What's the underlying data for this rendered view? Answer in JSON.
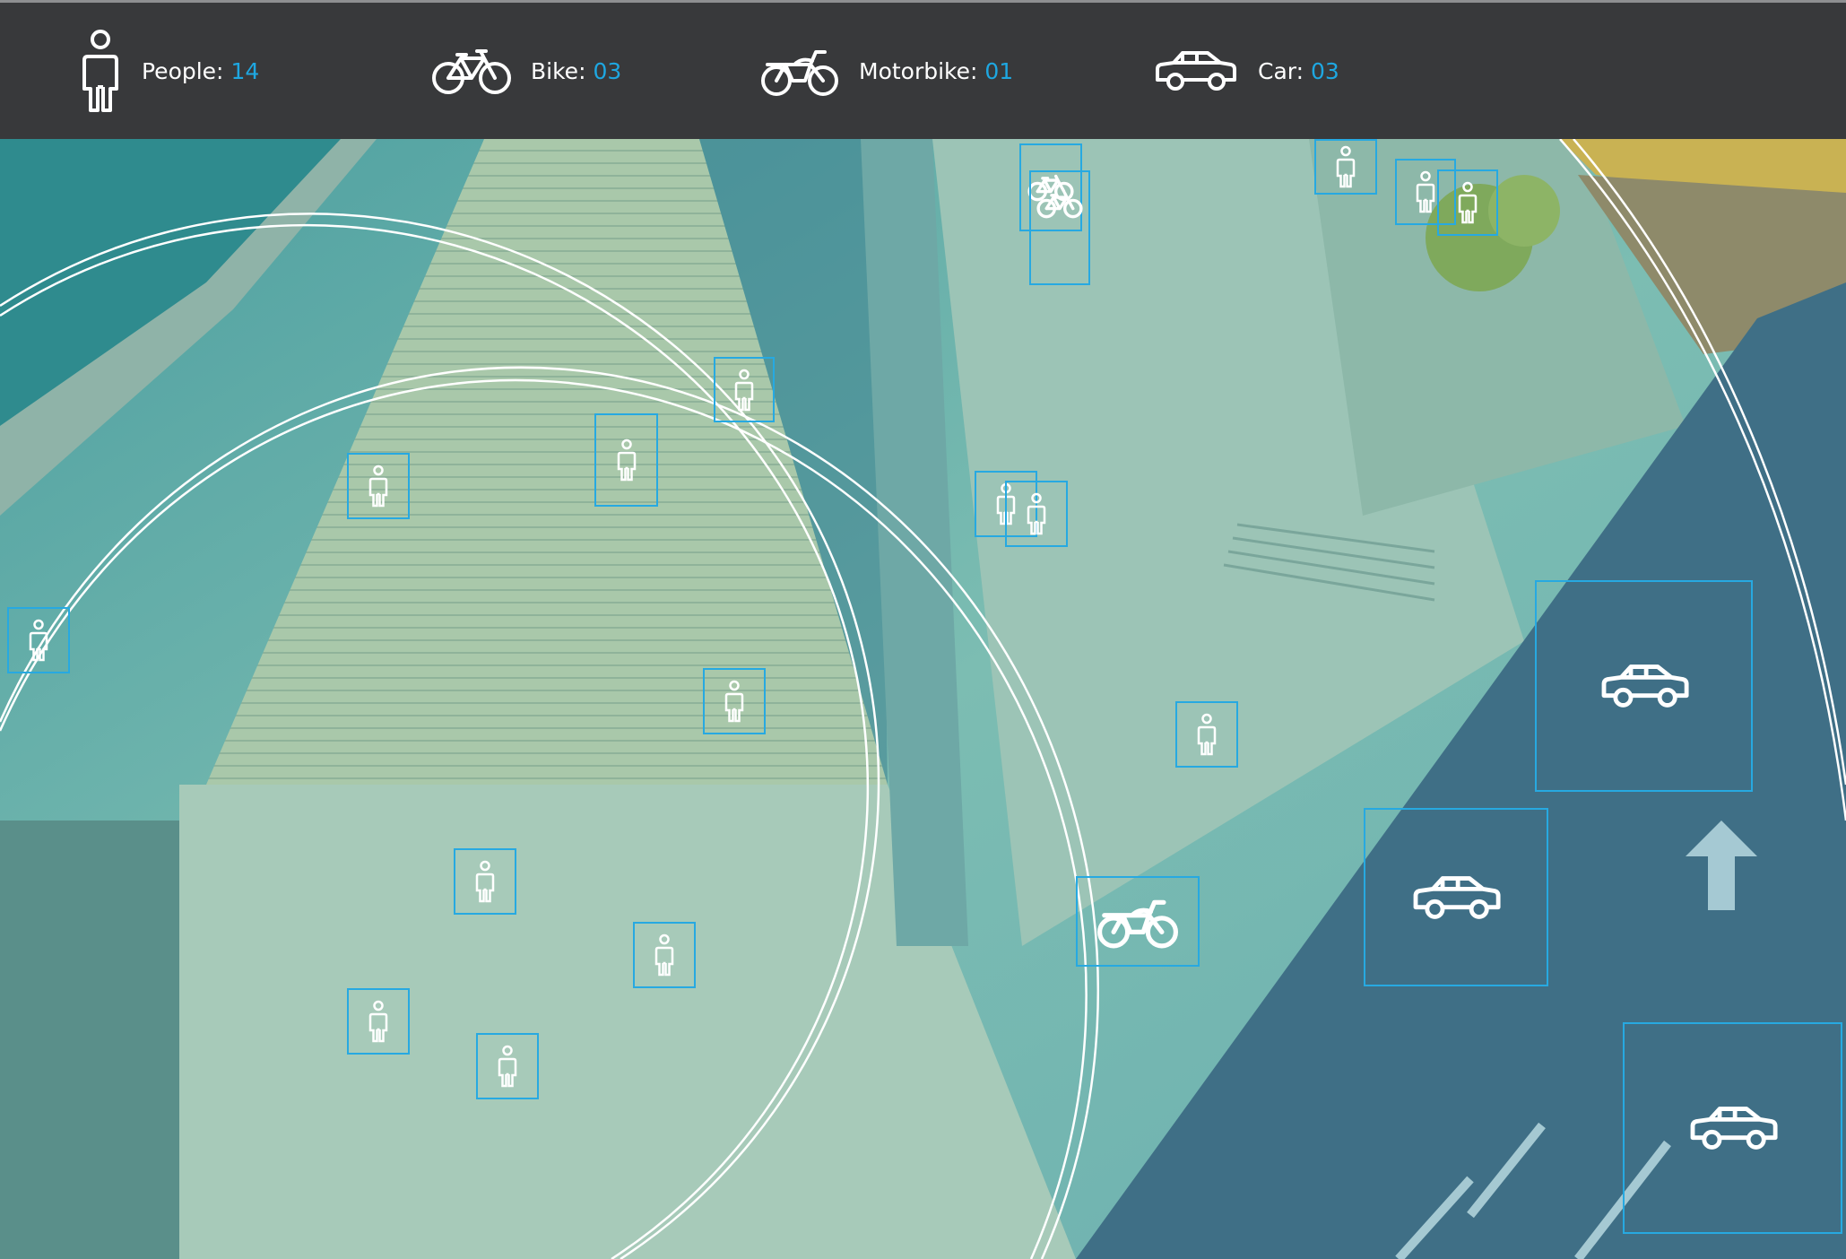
{
  "counters": [
    {
      "key": "people",
      "label": "People:",
      "value": "14",
      "icon": "person-icon"
    },
    {
      "key": "bike",
      "label": "Bike:",
      "value": "03",
      "icon": "bicycle-icon"
    },
    {
      "key": "motorbike",
      "label": "Motorbike:",
      "value": "01",
      "icon": "motorbike-icon"
    },
    {
      "key": "car",
      "label": "Car:",
      "value": "03",
      "icon": "car-icon"
    }
  ],
  "colors": {
    "bar_background": "#38393b",
    "accent": "#1ea7e1",
    "box_stroke": "#27a9e1",
    "label_text": "#ffffff",
    "scene_tint": "#5fb3b0"
  },
  "detections": [
    {
      "type": "person"
    },
    {
      "type": "person"
    },
    {
      "type": "person"
    },
    {
      "type": "person"
    },
    {
      "type": "person"
    },
    {
      "type": "person"
    },
    {
      "type": "person"
    },
    {
      "type": "person"
    },
    {
      "type": "person"
    },
    {
      "type": "person"
    },
    {
      "type": "person"
    },
    {
      "type": "person"
    },
    {
      "type": "person"
    },
    {
      "type": "person"
    },
    {
      "type": "person"
    },
    {
      "type": "person"
    },
    {
      "type": "person"
    },
    {
      "type": "bicycle"
    },
    {
      "type": "bicycle"
    },
    {
      "type": "motorbike"
    },
    {
      "type": "car"
    },
    {
      "type": "car"
    },
    {
      "type": "car"
    }
  ]
}
